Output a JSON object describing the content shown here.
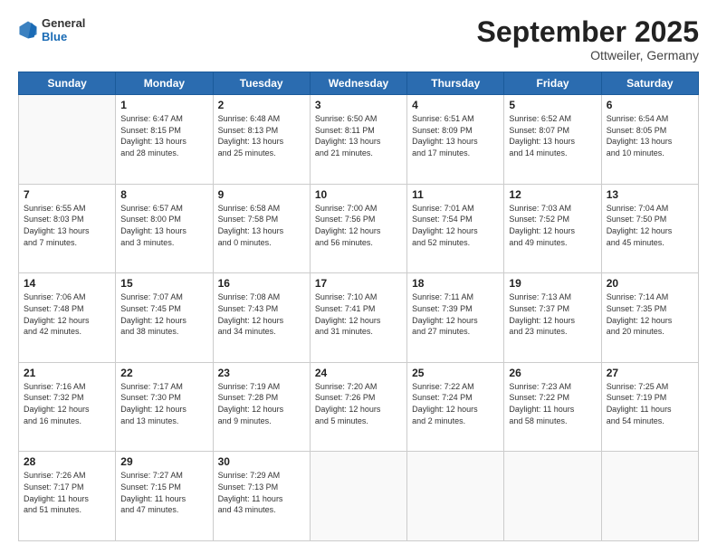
{
  "header": {
    "logo_general": "General",
    "logo_blue": "Blue",
    "month": "September 2025",
    "location": "Ottweiler, Germany"
  },
  "weekdays": [
    "Sunday",
    "Monday",
    "Tuesday",
    "Wednesday",
    "Thursday",
    "Friday",
    "Saturday"
  ],
  "weeks": [
    [
      {
        "day": "",
        "info": ""
      },
      {
        "day": "1",
        "info": "Sunrise: 6:47 AM\nSunset: 8:15 PM\nDaylight: 13 hours\nand 28 minutes."
      },
      {
        "day": "2",
        "info": "Sunrise: 6:48 AM\nSunset: 8:13 PM\nDaylight: 13 hours\nand 25 minutes."
      },
      {
        "day": "3",
        "info": "Sunrise: 6:50 AM\nSunset: 8:11 PM\nDaylight: 13 hours\nand 21 minutes."
      },
      {
        "day": "4",
        "info": "Sunrise: 6:51 AM\nSunset: 8:09 PM\nDaylight: 13 hours\nand 17 minutes."
      },
      {
        "day": "5",
        "info": "Sunrise: 6:52 AM\nSunset: 8:07 PM\nDaylight: 13 hours\nand 14 minutes."
      },
      {
        "day": "6",
        "info": "Sunrise: 6:54 AM\nSunset: 8:05 PM\nDaylight: 13 hours\nand 10 minutes."
      }
    ],
    [
      {
        "day": "7",
        "info": "Sunrise: 6:55 AM\nSunset: 8:03 PM\nDaylight: 13 hours\nand 7 minutes."
      },
      {
        "day": "8",
        "info": "Sunrise: 6:57 AM\nSunset: 8:00 PM\nDaylight: 13 hours\nand 3 minutes."
      },
      {
        "day": "9",
        "info": "Sunrise: 6:58 AM\nSunset: 7:58 PM\nDaylight: 13 hours\nand 0 minutes."
      },
      {
        "day": "10",
        "info": "Sunrise: 7:00 AM\nSunset: 7:56 PM\nDaylight: 12 hours\nand 56 minutes."
      },
      {
        "day": "11",
        "info": "Sunrise: 7:01 AM\nSunset: 7:54 PM\nDaylight: 12 hours\nand 52 minutes."
      },
      {
        "day": "12",
        "info": "Sunrise: 7:03 AM\nSunset: 7:52 PM\nDaylight: 12 hours\nand 49 minutes."
      },
      {
        "day": "13",
        "info": "Sunrise: 7:04 AM\nSunset: 7:50 PM\nDaylight: 12 hours\nand 45 minutes."
      }
    ],
    [
      {
        "day": "14",
        "info": "Sunrise: 7:06 AM\nSunset: 7:48 PM\nDaylight: 12 hours\nand 42 minutes."
      },
      {
        "day": "15",
        "info": "Sunrise: 7:07 AM\nSunset: 7:45 PM\nDaylight: 12 hours\nand 38 minutes."
      },
      {
        "day": "16",
        "info": "Sunrise: 7:08 AM\nSunset: 7:43 PM\nDaylight: 12 hours\nand 34 minutes."
      },
      {
        "day": "17",
        "info": "Sunrise: 7:10 AM\nSunset: 7:41 PM\nDaylight: 12 hours\nand 31 minutes."
      },
      {
        "day": "18",
        "info": "Sunrise: 7:11 AM\nSunset: 7:39 PM\nDaylight: 12 hours\nand 27 minutes."
      },
      {
        "day": "19",
        "info": "Sunrise: 7:13 AM\nSunset: 7:37 PM\nDaylight: 12 hours\nand 23 minutes."
      },
      {
        "day": "20",
        "info": "Sunrise: 7:14 AM\nSunset: 7:35 PM\nDaylight: 12 hours\nand 20 minutes."
      }
    ],
    [
      {
        "day": "21",
        "info": "Sunrise: 7:16 AM\nSunset: 7:32 PM\nDaylight: 12 hours\nand 16 minutes."
      },
      {
        "day": "22",
        "info": "Sunrise: 7:17 AM\nSunset: 7:30 PM\nDaylight: 12 hours\nand 13 minutes."
      },
      {
        "day": "23",
        "info": "Sunrise: 7:19 AM\nSunset: 7:28 PM\nDaylight: 12 hours\nand 9 minutes."
      },
      {
        "day": "24",
        "info": "Sunrise: 7:20 AM\nSunset: 7:26 PM\nDaylight: 12 hours\nand 5 minutes."
      },
      {
        "day": "25",
        "info": "Sunrise: 7:22 AM\nSunset: 7:24 PM\nDaylight: 12 hours\nand 2 minutes."
      },
      {
        "day": "26",
        "info": "Sunrise: 7:23 AM\nSunset: 7:22 PM\nDaylight: 11 hours\nand 58 minutes."
      },
      {
        "day": "27",
        "info": "Sunrise: 7:25 AM\nSunset: 7:19 PM\nDaylight: 11 hours\nand 54 minutes."
      }
    ],
    [
      {
        "day": "28",
        "info": "Sunrise: 7:26 AM\nSunset: 7:17 PM\nDaylight: 11 hours\nand 51 minutes."
      },
      {
        "day": "29",
        "info": "Sunrise: 7:27 AM\nSunset: 7:15 PM\nDaylight: 11 hours\nand 47 minutes."
      },
      {
        "day": "30",
        "info": "Sunrise: 7:29 AM\nSunset: 7:13 PM\nDaylight: 11 hours\nand 43 minutes."
      },
      {
        "day": "",
        "info": ""
      },
      {
        "day": "",
        "info": ""
      },
      {
        "day": "",
        "info": ""
      },
      {
        "day": "",
        "info": ""
      }
    ]
  ]
}
